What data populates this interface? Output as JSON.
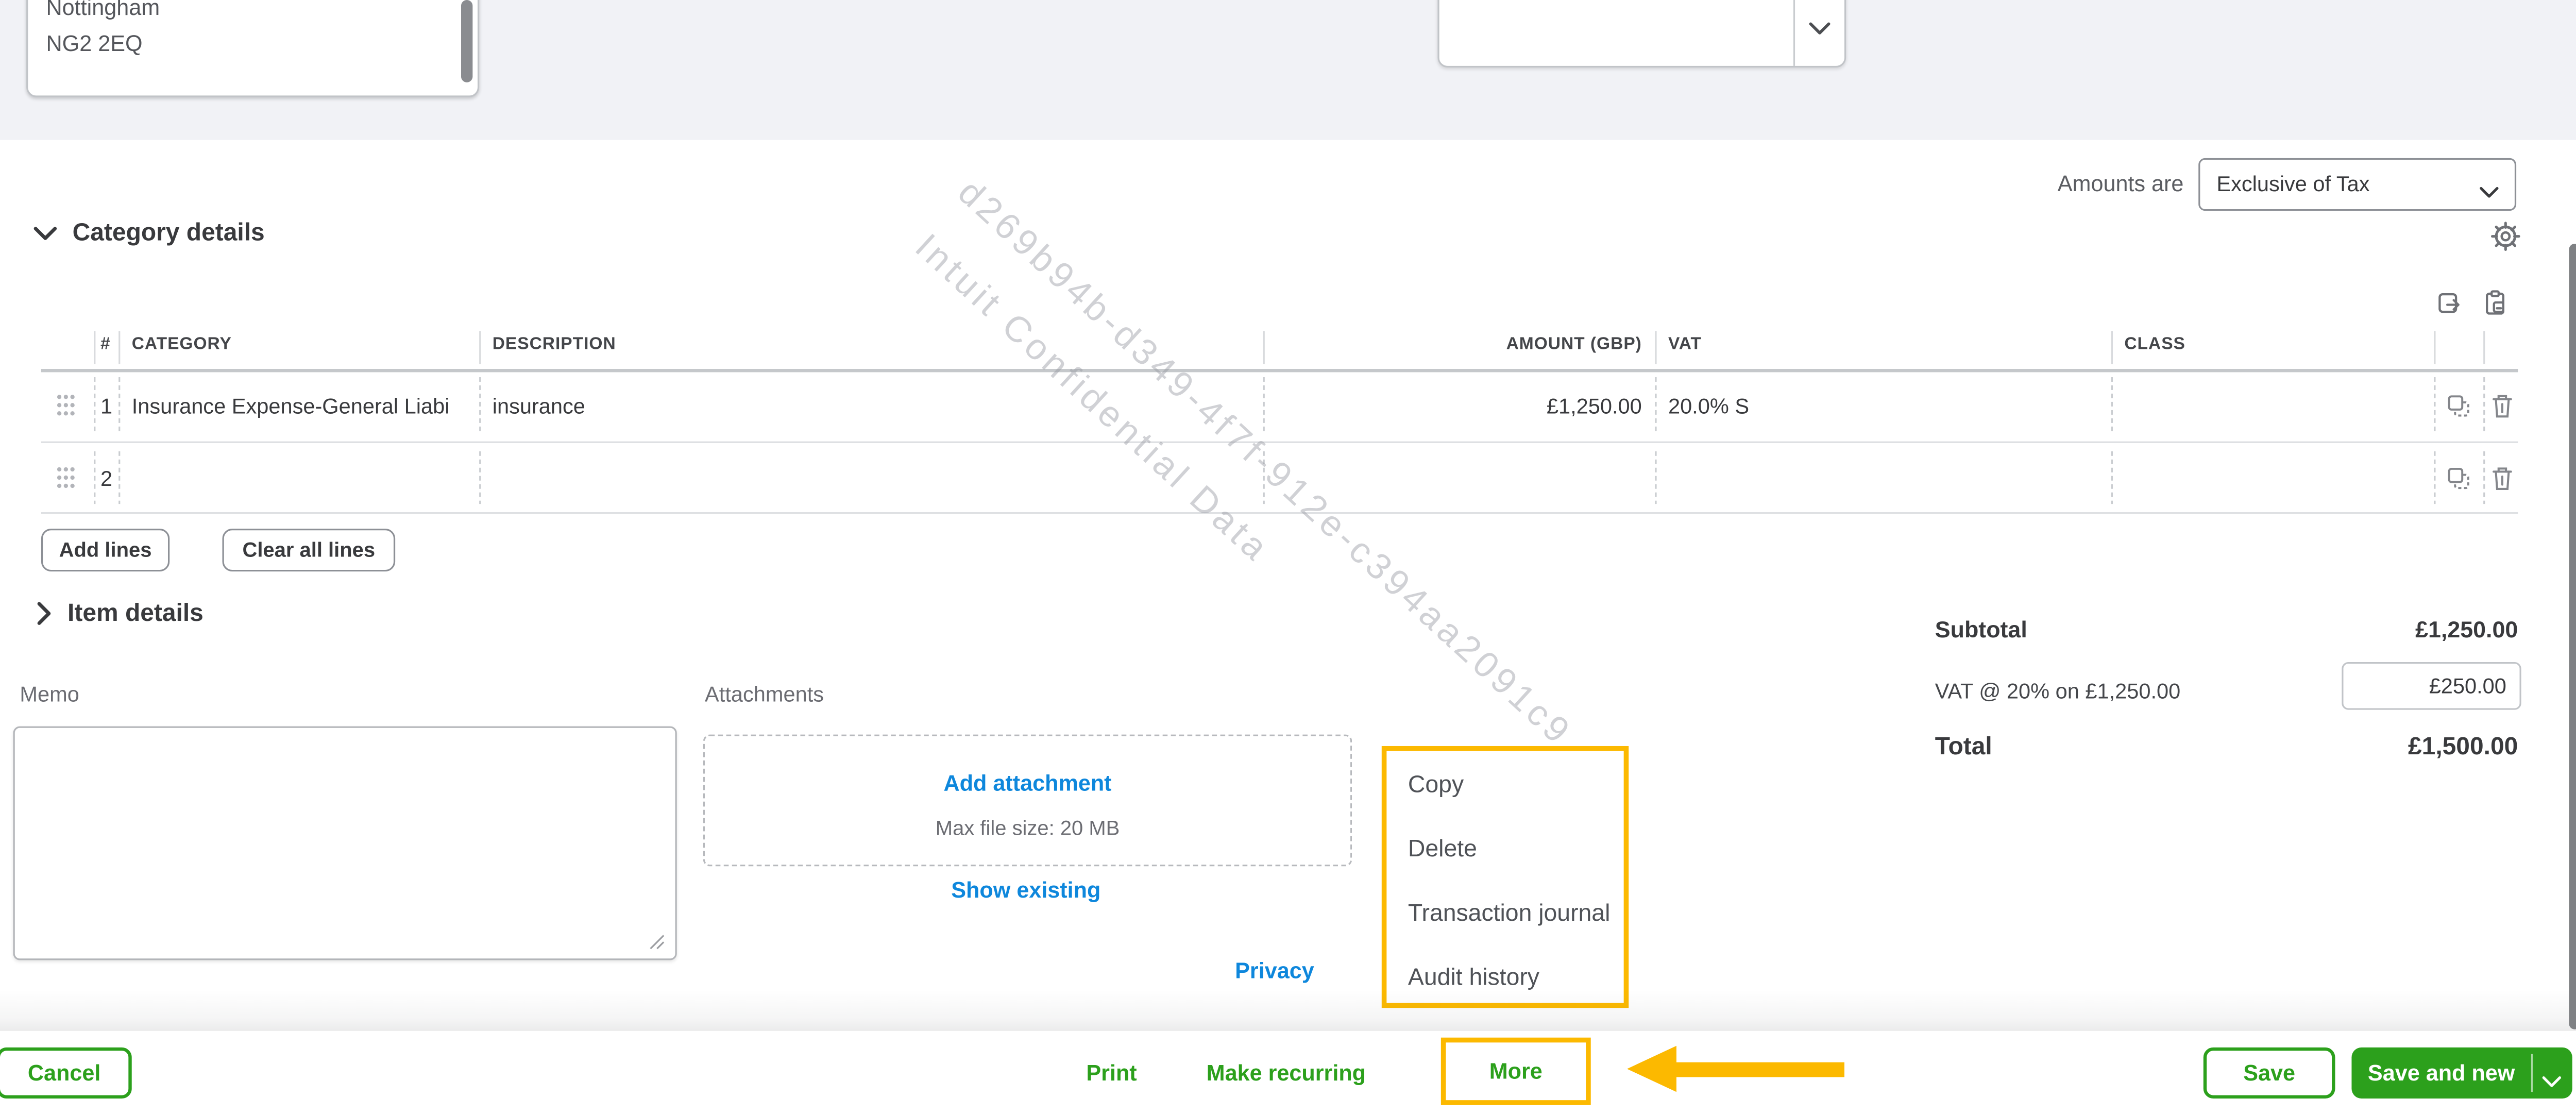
{
  "topbar": {
    "address_lines": [
      "Nottingham",
      "NG2 2EQ"
    ],
    "amounts_are_label": "Amounts are",
    "amounts_are_value": "Exclusive of Tax"
  },
  "category_section": {
    "title": "Category details"
  },
  "table": {
    "headers": {
      "num": "#",
      "category": "CATEGORY",
      "description": "DESCRIPTION",
      "amount": "AMOUNT (GBP)",
      "vat": "VAT",
      "class": "CLASS"
    },
    "rows": [
      {
        "num": "1",
        "category": "Insurance Expense-General Liabi",
        "description": "insurance",
        "amount": "£1,250.00",
        "vat": "20.0% S",
        "class": ""
      },
      {
        "num": "2",
        "category": "",
        "description": "",
        "amount": "",
        "vat": "",
        "class": ""
      }
    ],
    "add_lines": "Add lines",
    "clear_all_lines": "Clear all lines"
  },
  "item_section": {
    "title": "Item details"
  },
  "memo": {
    "label": "Memo",
    "value": ""
  },
  "attachments": {
    "label": "Attachments",
    "add_link": "Add attachment",
    "max_note": "Max file size: 20 MB",
    "show_link": "Show existing"
  },
  "privacy_link": "Privacy",
  "totals": {
    "subtotal_label": "Subtotal",
    "subtotal_value": "£1,250.00",
    "vat_label": "VAT @ 20% on £1,250.00",
    "vat_input_value": "£250.00",
    "total_label": "Total",
    "total_value": "£1,500.00"
  },
  "context_menu": {
    "items": [
      "Copy",
      "Delete",
      "Transaction journal",
      "Audit history"
    ]
  },
  "footer": {
    "cancel": "Cancel",
    "print": "Print",
    "make_recurring": "Make recurring",
    "more": "More",
    "save": "Save",
    "save_and_new": "Save and new"
  },
  "watermark": {
    "line1": "d269b94b-d349-4f7f-912e-c394aa2091c9",
    "line2": "Intuit Confidential Data"
  },
  "colors": {
    "brand_green": "#2ca01c",
    "highlight_yellow": "#fcb900",
    "link_blue": "#0e87dc"
  }
}
